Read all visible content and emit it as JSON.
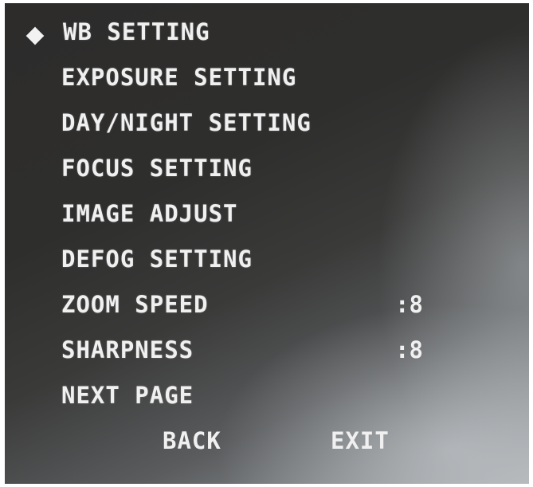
{
  "menu": {
    "cursor_icon": "diamond-icon",
    "items": [
      {
        "label": "WB SETTING"
      },
      {
        "label": "EXPOSURE SETTING"
      },
      {
        "label": "DAY/NIGHT SETTING"
      },
      {
        "label": "FOCUS SETTING"
      },
      {
        "label": "IMAGE ADJUST"
      },
      {
        "label": "DEFOG SETTING"
      },
      {
        "label": "ZOOM SPEED",
        "value": ":8"
      },
      {
        "label": "SHARPNESS",
        "value": ":8"
      },
      {
        "label": "NEXT PAGE"
      }
    ],
    "back_label": "BACK",
    "exit_label": "EXIT",
    "selected_index": 0
  },
  "colors": {
    "text": "#f0f0f0",
    "background": "#2e2e2d"
  }
}
